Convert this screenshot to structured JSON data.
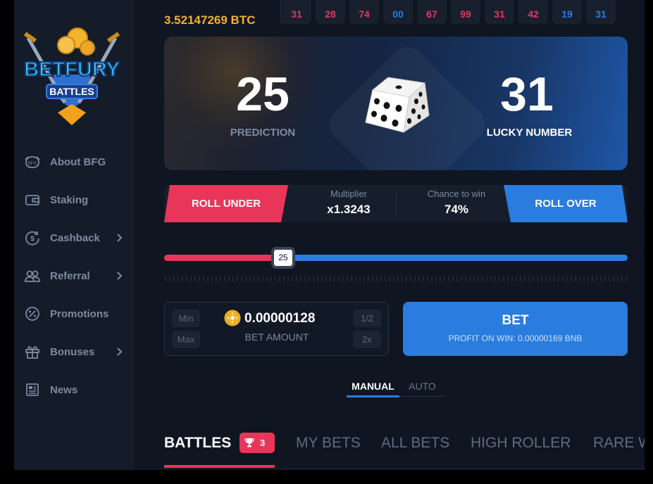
{
  "sidebar": {
    "logo": {
      "line1": "BETFURY",
      "line2": "BATTLES"
    },
    "items": [
      {
        "label": "About BFG",
        "icon": "bfg-coin-icon",
        "has_submenu": false
      },
      {
        "label": "Staking",
        "icon": "wallet-icon",
        "has_submenu": false
      },
      {
        "label": "Cashback",
        "icon": "cashback-icon",
        "has_submenu": true
      },
      {
        "label": "Referral",
        "icon": "users-icon",
        "has_submenu": true
      },
      {
        "label": "Promotions",
        "icon": "percent-icon",
        "has_submenu": false
      },
      {
        "label": "Bonuses",
        "icon": "gift-icon",
        "has_submenu": true
      },
      {
        "label": "News",
        "icon": "newspaper-icon",
        "has_submenu": false
      }
    ]
  },
  "balance": "3.52147269 BTC",
  "history": [
    {
      "value": "31",
      "color": "red"
    },
    {
      "value": "28",
      "color": "red"
    },
    {
      "value": "74",
      "color": "red"
    },
    {
      "value": "00",
      "color": "blue"
    },
    {
      "value": "67",
      "color": "red"
    },
    {
      "value": "99",
      "color": "red"
    },
    {
      "value": "31",
      "color": "red"
    },
    {
      "value": "42",
      "color": "red"
    },
    {
      "value": "19",
      "color": "blue"
    },
    {
      "value": "31",
      "color": "blue"
    }
  ],
  "hero": {
    "prediction_value": "25",
    "prediction_label": "PREDICTION",
    "lucky_value": "31",
    "lucky_label": "LUCKY NUMBER"
  },
  "roll": {
    "under_label": "ROLL UNDER",
    "over_label": "ROLL OVER",
    "multiplier_caption": "Multiplier",
    "multiplier_value": "x1.3243",
    "chance_caption": "Chance to win",
    "chance_value": "74%"
  },
  "slider": {
    "value": "25"
  },
  "bet_amount": {
    "value": "0.00000128",
    "label": "BET AMOUNT",
    "min_label": "Min",
    "max_label": "Max",
    "half_label": "1/2",
    "double_label": "2x",
    "currency_icon": "bnb-coin-icon"
  },
  "bet_button": {
    "label": "BET",
    "profit": "PROFIT ON WIN: 0.00000169 BNB"
  },
  "mode_tabs": {
    "manual": "MANUAL",
    "auto": "AUTO",
    "active": "manual"
  },
  "bottom_tabs": {
    "battles": "BATTLES",
    "battles_count": "3",
    "my_bets": "MY BETS",
    "all_bets": "ALL BETS",
    "high_roller": "HIGH ROLLER",
    "rare_wins": "RARE W"
  },
  "colors": {
    "accent_red": "#e8365a",
    "accent_blue": "#2a7cdf",
    "balance_gold": "#f5b02e",
    "background": "#0f1521",
    "sidebar": "#141c29"
  }
}
